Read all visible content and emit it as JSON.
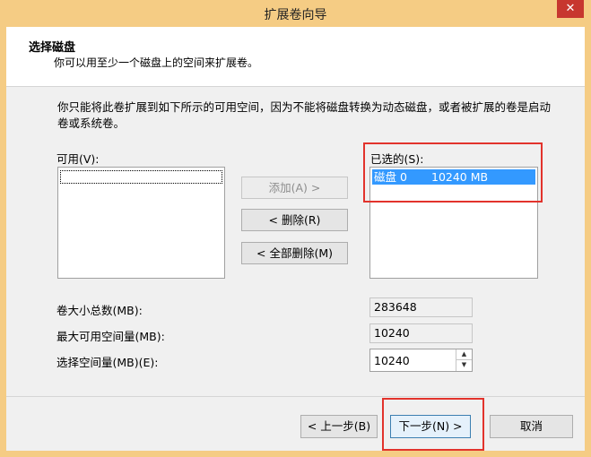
{
  "window": {
    "title": "扩展卷向导",
    "close_glyph": "✕"
  },
  "header": {
    "title": "选择磁盘",
    "subtitle": "你可以用至少一个磁盘上的空间来扩展卷。"
  },
  "description": "你只能将此卷扩展到如下所示的可用空间，因为不能将磁盘转换为动态磁盘，或者被扩展的卷是启动卷或系统卷。",
  "available": {
    "label": "可用(V):",
    "items": []
  },
  "selected": {
    "label": "已选的(S):",
    "items": [
      {
        "disk": "磁盘 0",
        "size": "10240 MB"
      }
    ]
  },
  "buttons": {
    "add": "添加(A) >",
    "remove": "< 删除(R)",
    "remove_all": "< 全部删除(M)"
  },
  "fields": {
    "total_size_label": "卷大小总数(MB):",
    "total_size": "283648",
    "max_space_label": "最大可用空间量(MB):",
    "max_space": "10240",
    "select_space_label": "选择空间量(MB)(E):",
    "select_space": "10240"
  },
  "footer": {
    "back": "< 上一步(B)",
    "next": "下一步(N) >",
    "cancel": "取消"
  },
  "colors": {
    "frame": "#f5cc84",
    "selection": "#3399ff",
    "highlight": "#e2332c",
    "close": "#c7372f"
  }
}
